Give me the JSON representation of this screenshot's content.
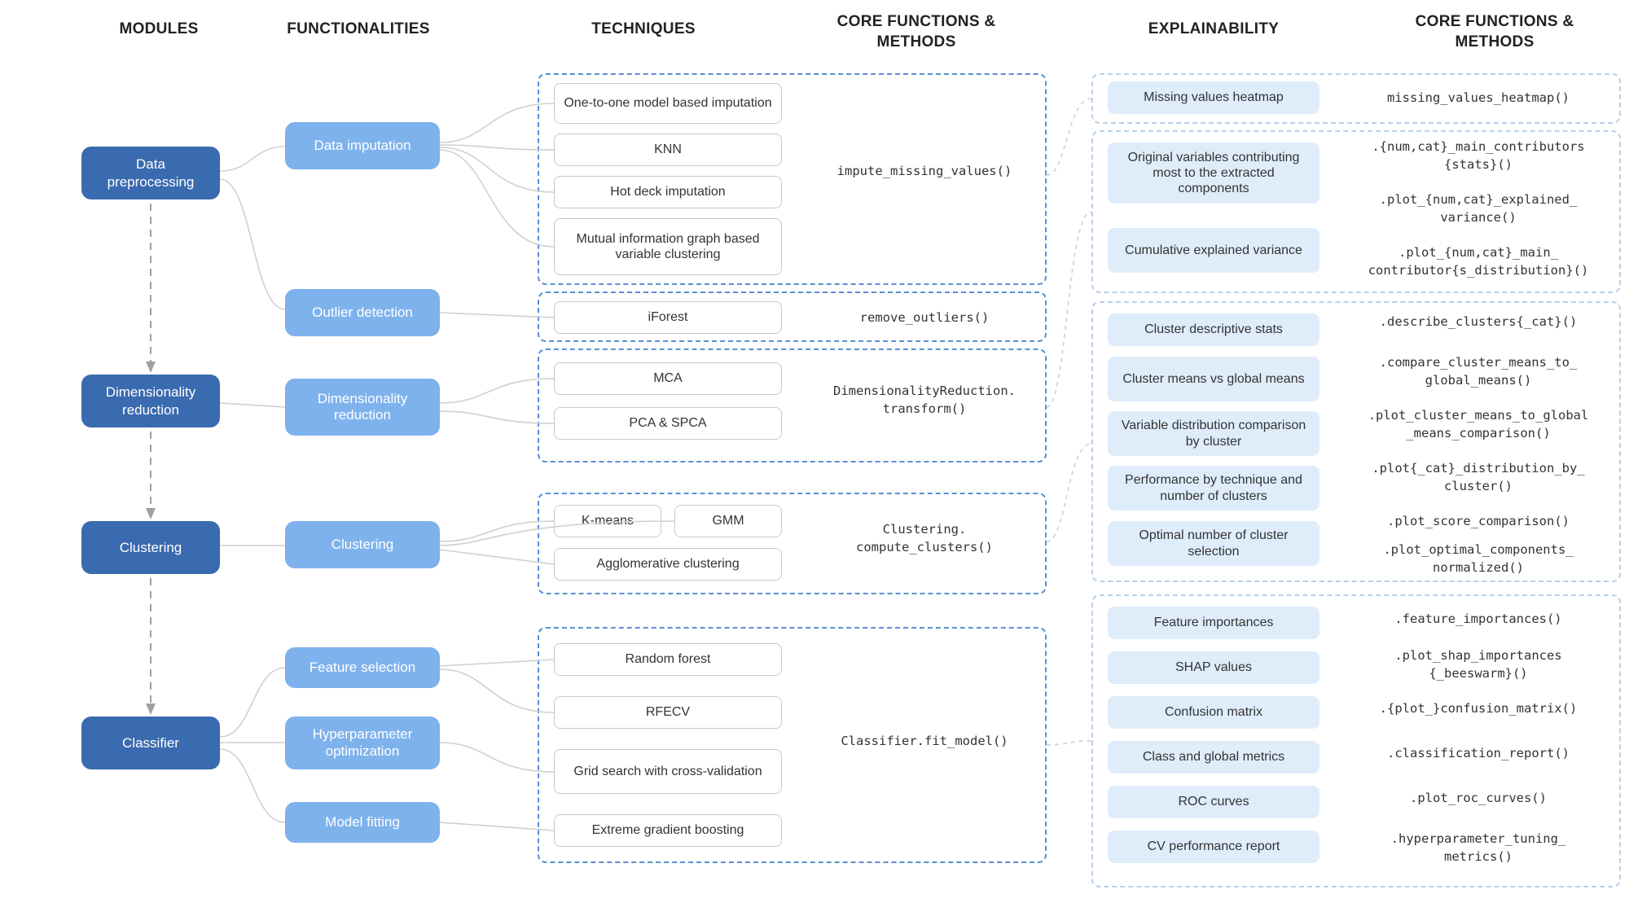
{
  "headers": {
    "modules": "MODULES",
    "functionalities": "FUNCTIONALITIES",
    "techniques": "TECHNIQUES",
    "core1": "CORE FUNCTIONS & METHODS",
    "explainability": "EXPLAINABILITY",
    "core2": "CORE FUNCTIONS & METHODS"
  },
  "modules": {
    "preprocessing": "Data preprocessing",
    "dimred": "Dimensionality reduction",
    "clustering": "Clustering",
    "classifier": "Classifier"
  },
  "funcs": {
    "imputation": "Data imputation",
    "outlier": "Outlier detection",
    "dimred": "Dimensionality reduction",
    "clustering": "Clustering",
    "featsel": "Feature selection",
    "hyper": "Hyperparameter optimization",
    "modelfit": "Model fitting"
  },
  "tech": {
    "onetoone": "One-to-one model based imputation",
    "knn": "KNN",
    "hotdeck": "Hot deck imputation",
    "mi_graph": "Mutual information graph based variable clustering",
    "iforest": "iForest",
    "mca": "MCA",
    "pca": "PCA & SPCA",
    "kmeans": "K-means",
    "gmm": "GMM",
    "agg": "Agglomerative clustering",
    "rf": "Random forest",
    "rfecv": "RFECV",
    "gridcv": "Grid search with cross-validation",
    "xgb": "Extreme gradient boosting"
  },
  "core": {
    "impute": "impute_missing_values()",
    "remove": "remove_outliers()",
    "dimred_l1": "DimensionalityReduction.",
    "dimred_l2": "transform()",
    "clust_l1": "Clustering.",
    "clust_l2": "compute_clusters()",
    "classifier": "Classifier.fit_model()"
  },
  "expl": {
    "missing_heat": "Missing values heatmap",
    "orig_vars": "Original variables contributing most to the extracted components",
    "cum_var": "Cumulative explained variance",
    "cluster_desc": "Cluster descriptive stats",
    "cluster_means": "Cluster means vs global means",
    "var_dist": "Variable distribution comparison by cluster",
    "perf_tech": "Performance by technique and number of clusters",
    "opt_num": "Optimal number of cluster selection",
    "feat_imp": "Feature importances",
    "shap": "SHAP values",
    "conf": "Confusion matrix",
    "class_metrics": "Class and global metrics",
    "roc": "ROC curves",
    "cv_perf": "CV performance report"
  },
  "core2": {
    "missing_heat": "missing_values_heatmap()",
    "main_contrib_l1": ".{num,cat}_main_contributors",
    "main_contrib_l2": "{stats}()",
    "expl_var_l1": ".plot_{num,cat}_explained_",
    "expl_var_l2": "variance()",
    "main_contrib_dist_l1": ".plot_{num,cat}_main_",
    "main_contrib_dist_l2": "contributor{s_distribution}()",
    "describe": ".describe_clusters{_cat}()",
    "compare_l1": ".compare_cluster_means_to_",
    "compare_l2": "global_means()",
    "plot_cluster_l1": ".plot_cluster_means_to_global",
    "plot_cluster_l2": "_means_comparison()",
    "plot_dist_l1": ".plot{_cat}_distribution_by_",
    "plot_dist_l2": "cluster()",
    "score_comp": ".plot_score_comparison()",
    "opt_comp_l1": ".plot_optimal_components_",
    "opt_comp_l2": "normalized()",
    "feat_imp": ".feature_importances()",
    "shap_l1": ".plot_shap_importances",
    "shap_l2": "{_beeswarm}()",
    "conf": ".{plot_}confusion_matrix()",
    "class_rep": ".classification_report()",
    "roc": ".plot_roc_curves()",
    "hyper_l1": ".hyperparameter_tuning_",
    "hyper_l2": "metrics()"
  }
}
